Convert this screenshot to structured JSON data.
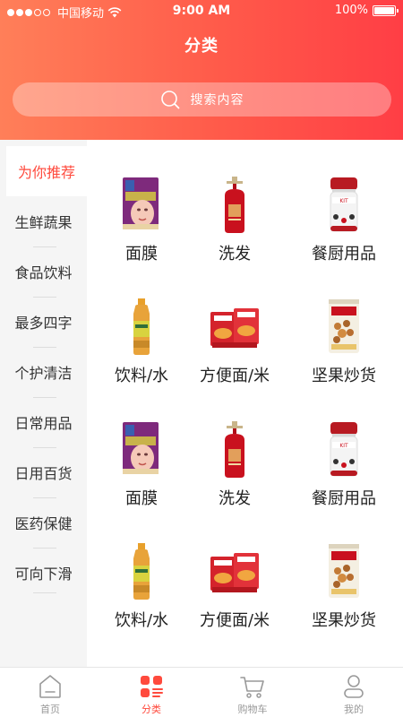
{
  "status_bar": {
    "carrier": "中国移动",
    "time": "9:00 AM",
    "battery": "100%",
    "battery_level": 1.0
  },
  "header": {
    "title": "分类"
  },
  "search": {
    "placeholder": "搜索内容"
  },
  "sidebar": {
    "active_index": 0,
    "items": [
      {
        "label": "为你推荐"
      },
      {
        "label": "生鲜蔬果"
      },
      {
        "label": "食品饮料"
      },
      {
        "label": "最多四字"
      },
      {
        "label": "个护清洁"
      },
      {
        "label": "日常用品"
      },
      {
        "label": "日用百货"
      },
      {
        "label": "医药保健"
      },
      {
        "label": "可向下滑"
      }
    ]
  },
  "products": [
    {
      "label": "面膜",
      "icon": "face-mask-icon"
    },
    {
      "label": "洗发",
      "icon": "shampoo-bottle-icon"
    },
    {
      "label": "餐厨用品",
      "icon": "food-jar-icon"
    },
    {
      "label": "饮料/水",
      "icon": "drink-bottle-icon"
    },
    {
      "label": "方便面/米",
      "icon": "instant-noodles-icon"
    },
    {
      "label": "坚果炒货",
      "icon": "nut-snack-icon"
    },
    {
      "label": "面膜",
      "icon": "face-mask-icon"
    },
    {
      "label": "洗发",
      "icon": "shampoo-bottle-icon"
    },
    {
      "label": "餐厨用品",
      "icon": "food-jar-icon"
    },
    {
      "label": "饮料/水",
      "icon": "drink-bottle-icon"
    },
    {
      "label": "方便面/米",
      "icon": "instant-noodles-icon"
    },
    {
      "label": "坚果炒货",
      "icon": "nut-snack-icon"
    }
  ],
  "tabbar": {
    "active_index": 1,
    "tabs": [
      {
        "label": "首页",
        "icon": "home-icon"
      },
      {
        "label": "分类",
        "icon": "category-icon"
      },
      {
        "label": "购物车",
        "icon": "cart-icon"
      },
      {
        "label": "我的",
        "icon": "profile-icon"
      }
    ]
  },
  "colors": {
    "accent": "#ff4a3d",
    "header_gradient_start": "#ff7f59",
    "header_gradient_end": "#ff3e45",
    "sidebar_bg": "#f5f5f5"
  }
}
